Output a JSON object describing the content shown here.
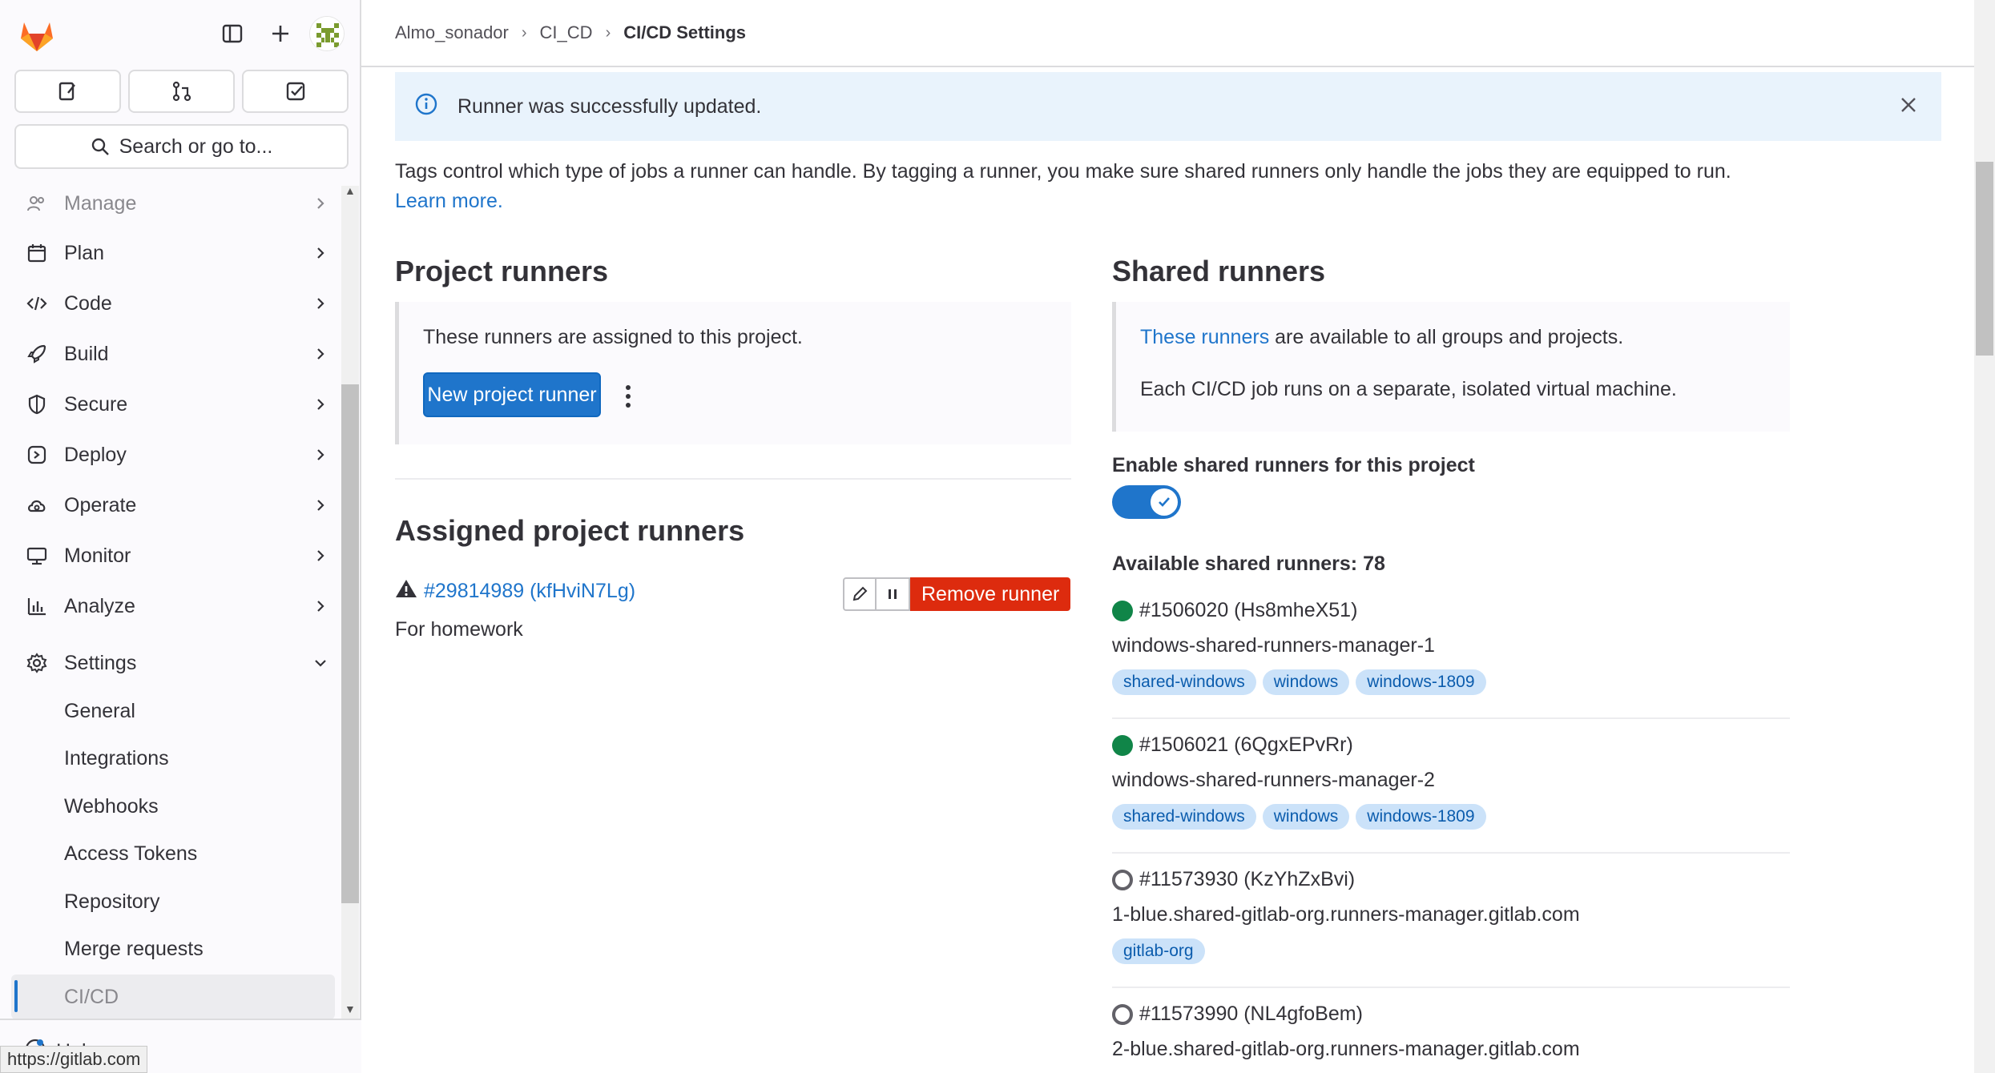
{
  "sidebar": {
    "search_label": "Search or go to...",
    "nav": [
      {
        "label": "Manage",
        "icon": "users-icon",
        "muted": true
      },
      {
        "label": "Plan",
        "icon": "calendar-icon"
      },
      {
        "label": "Code",
        "icon": "code-icon"
      },
      {
        "label": "Build",
        "icon": "rocket-icon"
      },
      {
        "label": "Secure",
        "icon": "shield-icon"
      },
      {
        "label": "Deploy",
        "icon": "deploy-icon"
      },
      {
        "label": "Operate",
        "icon": "cloud-gear-icon"
      },
      {
        "label": "Monitor",
        "icon": "monitor-icon"
      },
      {
        "label": "Analyze",
        "icon": "chart-icon"
      },
      {
        "label": "Settings",
        "icon": "gear-icon"
      }
    ],
    "settings_sub": [
      "General",
      "Integrations",
      "Webhooks",
      "Access Tokens",
      "Repository",
      "Merge requests",
      "CI/CD"
    ],
    "help_label": "Help",
    "status_url": "https://gitlab.com"
  },
  "breadcrumb": {
    "items": [
      "Almo_sonador",
      "CI_CD"
    ],
    "current": "CI/CD Settings"
  },
  "alert": {
    "message": "Runner was successfully updated."
  },
  "intro": {
    "text": "Tags control which type of jobs a runner can handle. By tagging a runner, you make sure shared runners only handle the jobs they are equipped to run.",
    "link": "Learn more."
  },
  "project_runners": {
    "title": "Project runners",
    "panel_text": "These runners are assigned to this project.",
    "new_button": "New project runner",
    "assigned_title": "Assigned project runners",
    "runner_link": "#29814989 (kfHviN7Lg)",
    "runner_desc": "For homework",
    "remove_button": "Remove runner"
  },
  "shared_runners": {
    "title": "Shared runners",
    "panel_link": "These runners",
    "panel_text": " are available to all groups and projects.",
    "panel_text2": "Each CI/CD job runs on a separate, isolated virtual machine.",
    "toggle_label": "Enable shared runners for this project",
    "toggle_on": true,
    "available_label": "Available shared runners: 78",
    "runners": [
      {
        "id": "#1506020 (Hs8mheX51)",
        "desc": "windows-shared-runners-manager-1",
        "online": true,
        "tags": [
          "shared-windows",
          "windows",
          "windows-1809"
        ]
      },
      {
        "id": "#1506021 (6QgxEPvRr)",
        "desc": "windows-shared-runners-manager-2",
        "online": true,
        "tags": [
          "shared-windows",
          "windows",
          "windows-1809"
        ]
      },
      {
        "id": "#11573930 (KzYhZxBvi)",
        "desc": "1-blue.shared-gitlab-org.runners-manager.gitlab.com",
        "online": false,
        "tags": [
          "gitlab-org"
        ]
      },
      {
        "id": "#11573990 (NL4gfoBem)",
        "desc": "2-blue.shared-gitlab-org.runners-manager.gitlab.com",
        "online": false,
        "tags": []
      }
    ]
  },
  "colors": {
    "accent": "#1f75cb",
    "danger": "#dd2b0e",
    "online": "#108548",
    "alert_bg": "#e9f3fc"
  }
}
